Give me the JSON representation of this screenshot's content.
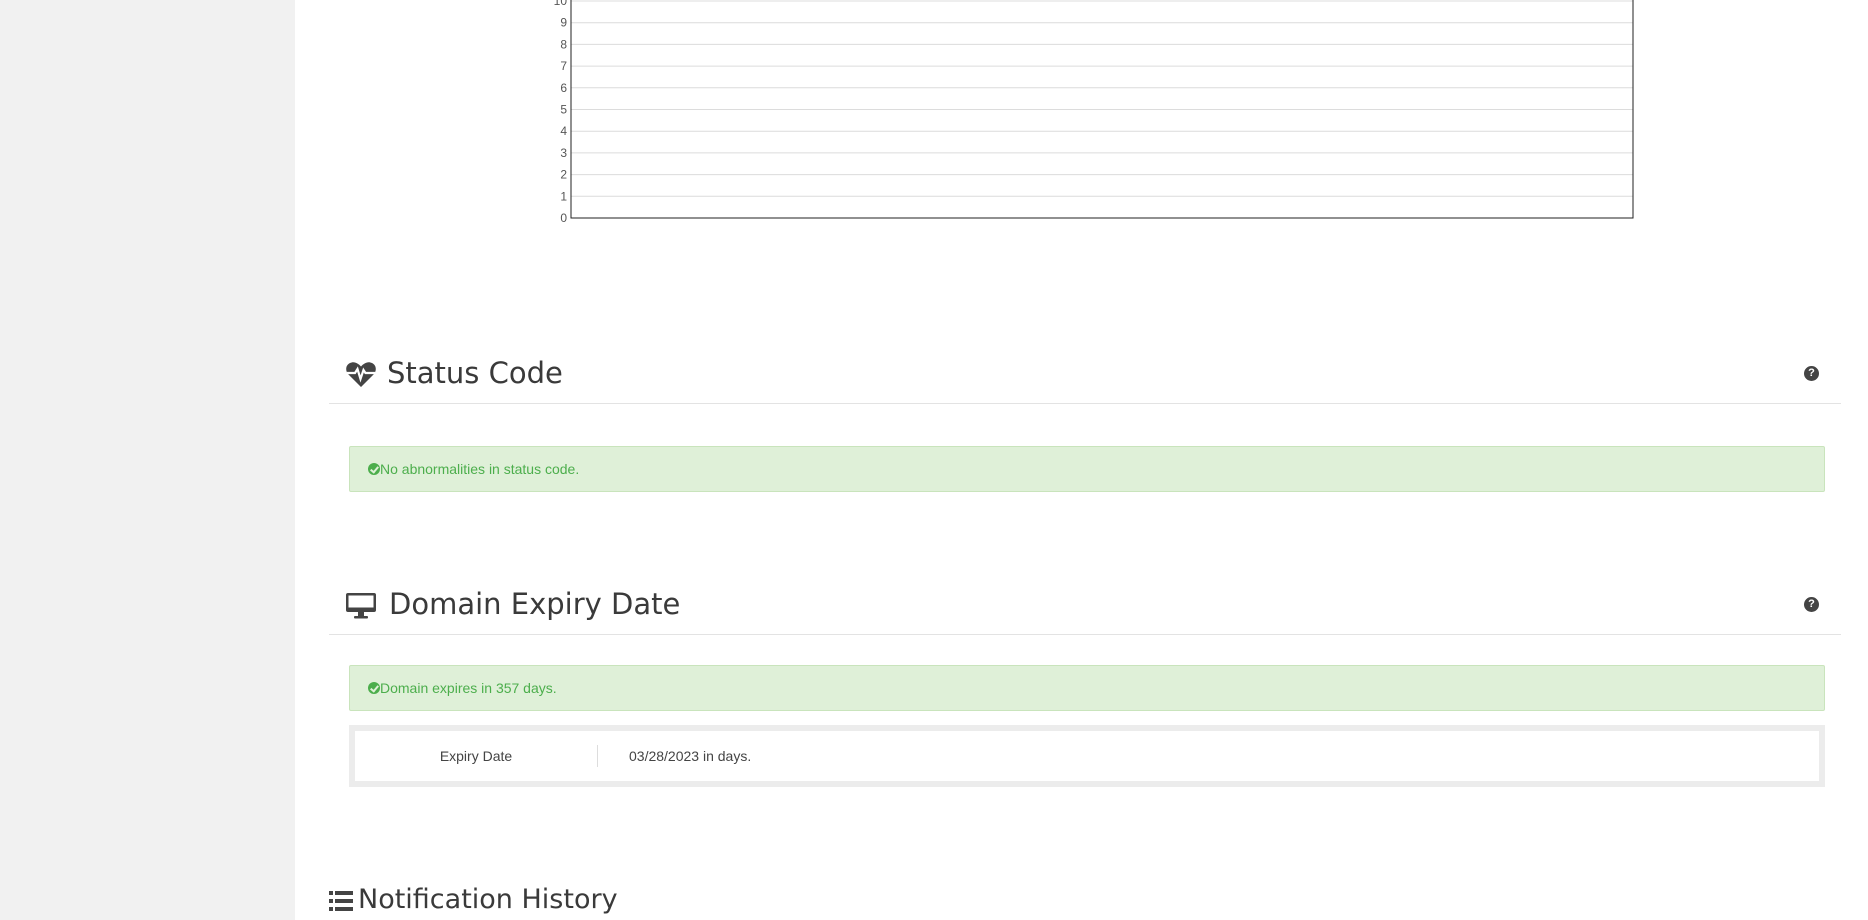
{
  "chart_data": {
    "type": "line",
    "yticks": [
      "0",
      "1",
      "2",
      "3",
      "4",
      "5",
      "6",
      "7",
      "8",
      "9",
      "10"
    ],
    "ylim": [
      0,
      10
    ],
    "series": [],
    "grid": true
  },
  "status_code": {
    "title": "Status Code",
    "help": "?",
    "alert": "No abnormalities in status code."
  },
  "domain_expiry": {
    "title": "Domain Expiry Date",
    "help": "?",
    "alert": "Domain expires in 357 days.",
    "table": {
      "label": "Expiry Date",
      "value": "03/28/2023 in days."
    }
  },
  "notification_history": {
    "title": "Notification History"
  },
  "colors": {
    "alert_bg": "#dff0d8",
    "alert_text": "#4cae4c",
    "sidebar_bg": "#f1f1f1"
  }
}
